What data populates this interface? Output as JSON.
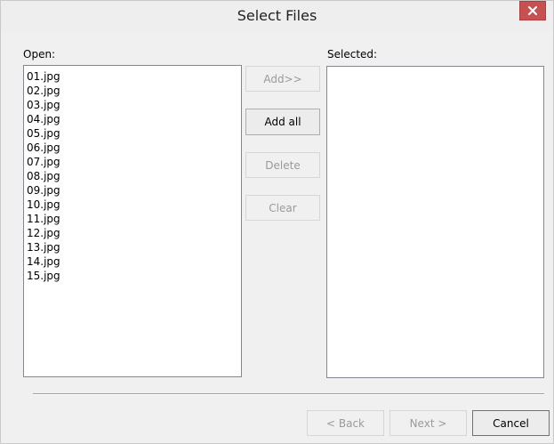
{
  "window": {
    "title": "Select Files"
  },
  "icons": {
    "close": "close-icon"
  },
  "open_panel": {
    "label": "Open:",
    "items": [
      "01.jpg",
      "02.jpg",
      "03.jpg",
      "04.jpg",
      "05.jpg",
      "06.jpg",
      "07.jpg",
      "08.jpg",
      "09.jpg",
      "10.jpg",
      "11.jpg",
      "12.jpg",
      "13.jpg",
      "14.jpg",
      "15.jpg"
    ]
  },
  "selected_panel": {
    "label": "Selected:"
  },
  "actions": {
    "add": "Add>>",
    "add_all": "Add all",
    "delete": "Delete",
    "clear": "Clear"
  },
  "footer": {
    "back": "< Back",
    "next": "Next >",
    "cancel": "Cancel"
  },
  "colors": {
    "close_button": "#c75050",
    "disabled_text": "#9a9a9a",
    "list_border": "#828790"
  }
}
